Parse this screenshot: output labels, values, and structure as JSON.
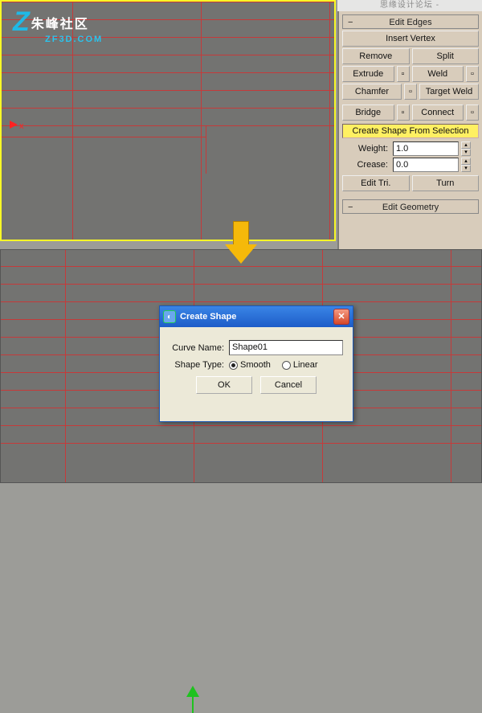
{
  "watermark_top": "思缘设计论坛 - WWW.MISSYUAN.COM",
  "logo": {
    "char": "Z",
    "cn": "朱峰社区",
    "sub": "ZF3D.COM"
  },
  "panel": {
    "rollouts": {
      "edit_edges": "Edit Edges",
      "edit_geometry": "Edit Geometry"
    },
    "insert_vertex": "Insert Vertex",
    "remove": "Remove",
    "split": "Split",
    "extrude": "Extrude",
    "weld": "Weld",
    "chamfer": "Chamfer",
    "target_weld": "Target Weld",
    "bridge": "Bridge",
    "connect": "Connect",
    "create_shape": "Create Shape From Selection",
    "weight_lbl": "Weight:",
    "weight_val": "1.0",
    "crease_lbl": "Crease:",
    "crease_val": "0.0",
    "edit_tri": "Edit Tri.",
    "turn": "Turn"
  },
  "axis": {
    "x_label": "x"
  },
  "dialog": {
    "title": "Create Shape",
    "curve_name_lbl": "Curve Name:",
    "curve_name_val": "Shape01",
    "shape_type_lbl": "Shape Type:",
    "opt_smooth": "Smooth",
    "opt_linear": "Linear",
    "ok": "OK",
    "cancel": "Cancel"
  }
}
